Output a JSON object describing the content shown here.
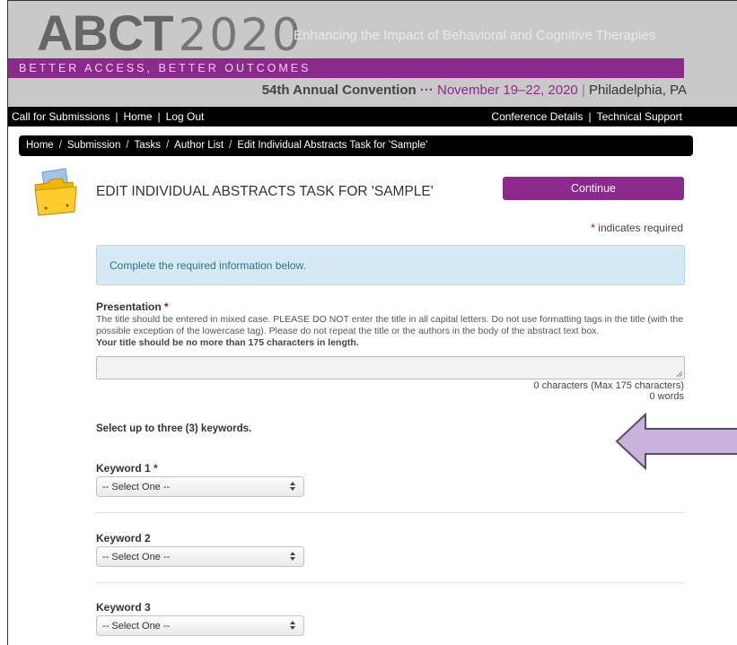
{
  "header": {
    "logo_text": "ABCT",
    "logo_year": "2020",
    "tagline": "Enhancing the Impact of Behavioral and Cognitive Therapies",
    "band_text": "BETTER ACCESS, BETTER OUTCOMES",
    "convention": "54th Annual Convention",
    "convention_dots": "···",
    "dates": "November 19–22, 2020",
    "separator": "|",
    "location": "Philadelphia, PA"
  },
  "nav": {
    "left": [
      "Call for Submissions",
      "Home",
      "Log Out"
    ],
    "right": [
      "Conference Details",
      "Technical Support"
    ],
    "sep": "|"
  },
  "breadcrumb": {
    "items": [
      "Home",
      "Submission",
      "Tasks",
      "Author List",
      "Edit Individual Abstracts Task for 'Sample'"
    ],
    "sep": "/"
  },
  "page": {
    "title": "EDIT INDIVIDUAL ABSTRACTS TASK FOR 'SAMPLE'",
    "continue_label": "Continue",
    "required_star": "*",
    "required_note": " indicates required",
    "info_message": "Complete the required information below."
  },
  "presentation": {
    "label": "Presentation",
    "star": "*",
    "desc_plain": "The title should be entered in mixed case. PLEASE DO NOT enter the title in all capital letters. Do not use formatting tags in the title (with the possible exception of the lowercase tag). Please do not repeat the title or the authors in the body of the abstract text box.",
    "desc_bold": "Your title should be no more than 175 characters in length.",
    "value": "",
    "char_count": "0 characters (Max 175 characters)",
    "word_count": "0 words"
  },
  "keywords": {
    "instruction": "Select up to three (3) keywords.",
    "items": [
      {
        "label": "Keyword 1",
        "required": "*",
        "selected": "-- Select One --"
      },
      {
        "label": "Keyword 2",
        "required": "",
        "selected": "-- Select One --"
      },
      {
        "label": "Keyword 3",
        "required": "",
        "selected": "-- Select One --"
      }
    ]
  },
  "colors": {
    "brand_purple": "#8c2a8c",
    "banner_gray": "#c9c9c9",
    "info_blue": "#d6eaf5",
    "arrow_fill": "#c9b3dd",
    "required_red": "#cc0000"
  },
  "icons": {
    "folder": "folder-icon",
    "arrow": "left-arrow-icon",
    "select_caret": "updown-caret-icon"
  }
}
